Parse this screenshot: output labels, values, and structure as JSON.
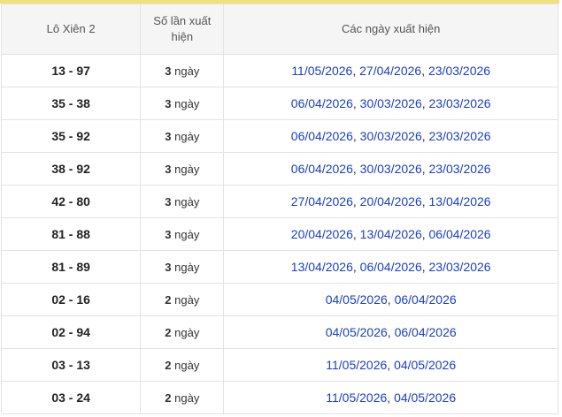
{
  "header": {
    "col_pair": "Lô Xiên 2",
    "col_count": "Số lần xuất hiện",
    "col_dates": "Các ngày xuất hiện"
  },
  "unit": "ngày",
  "rows": [
    {
      "pair": "13 - 97",
      "count": "3",
      "dates": [
        "11/05/2026",
        "27/04/2026",
        "23/03/2026"
      ]
    },
    {
      "pair": "35 - 38",
      "count": "3",
      "dates": [
        "06/04/2026",
        "30/03/2026",
        "23/03/2026"
      ]
    },
    {
      "pair": "35 - 92",
      "count": "3",
      "dates": [
        "06/04/2026",
        "30/03/2026",
        "23/03/2026"
      ]
    },
    {
      "pair": "38 - 92",
      "count": "3",
      "dates": [
        "06/04/2026",
        "30/03/2026",
        "23/03/2026"
      ]
    },
    {
      "pair": "42 - 80",
      "count": "3",
      "dates": [
        "27/04/2026",
        "20/04/2026",
        "13/04/2026"
      ]
    },
    {
      "pair": "81 - 88",
      "count": "3",
      "dates": [
        "20/04/2026",
        "13/04/2026",
        "06/04/2026"
      ]
    },
    {
      "pair": "81 - 89",
      "count": "3",
      "dates": [
        "13/04/2026",
        "06/04/2026",
        "23/03/2026"
      ]
    },
    {
      "pair": "02 - 16",
      "count": "2",
      "dates": [
        "04/05/2026",
        "06/04/2026"
      ]
    },
    {
      "pair": "02 - 94",
      "count": "2",
      "dates": [
        "04/05/2026",
        "06/04/2026"
      ]
    },
    {
      "pair": "03 - 13",
      "count": "2",
      "dates": [
        "11/05/2026",
        "04/05/2026"
      ]
    },
    {
      "pair": "03 - 24",
      "count": "2",
      "dates": [
        "11/05/2026",
        "04/05/2026"
      ]
    }
  ],
  "colors": {
    "accent_bar": "#f3e07a",
    "link": "#1a3ec9",
    "header_bg": "#f5f5f5"
  }
}
